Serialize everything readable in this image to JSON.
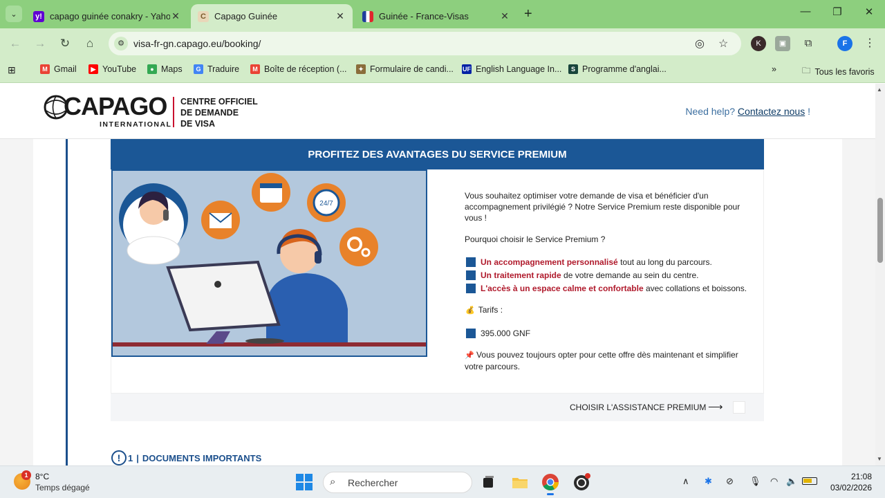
{
  "browser": {
    "tabs": [
      {
        "title": "capago guinée conakry - Yahoo",
        "favicon": "yahoo-icon",
        "active": false
      },
      {
        "title": "Capago Guinée",
        "favicon": "capago-icon",
        "active": true
      },
      {
        "title": "Guinée - France-Visas",
        "favicon": "france-flag-icon",
        "active": false
      }
    ],
    "close_glyph": "✕",
    "new_tab_glyph": "+",
    "url": "visa-fr-gn.capago.eu/booking/",
    "profile_letter": "F",
    "ext_letter": "K",
    "bookmarks": [
      {
        "label": "Gmail",
        "icon": "gmail-icon",
        "color": "#ea4335"
      },
      {
        "label": "YouTube",
        "icon": "youtube-icon",
        "color": "#ff0000"
      },
      {
        "label": "Maps",
        "icon": "maps-icon",
        "color": "#34a853"
      },
      {
        "label": "Traduire",
        "icon": "translate-icon",
        "color": "#4285f4"
      },
      {
        "label": "Boîte de réception (...",
        "icon": "gmail-icon",
        "color": "#ea4335"
      },
      {
        "label": "Formulaire de candi...",
        "icon": "emblem-icon",
        "color": "#8a6d3b"
      },
      {
        "label": "English Language In...",
        "icon": "uf-icon",
        "color": "#0021a5"
      },
      {
        "label": "Programme d'anglai...",
        "icon": "msu-icon",
        "color": "#18453b"
      }
    ],
    "all_bookmarks": "Tous les favoris"
  },
  "site": {
    "logo_main": "CAPAGO",
    "logo_sub": "INTERNATIONAL",
    "logo_lines": [
      "CENTRE OFFICIEL",
      "DE DEMANDE",
      "DE VISA"
    ],
    "help_text": "Need help?",
    "help_link": "Contactez nous",
    "help_suffix": "!"
  },
  "premium": {
    "banner": "PROFITEZ DES AVANTAGES DU SERVICE PREMIUM",
    "intro": "Vous souhaitez optimiser votre demande de visa et bénéficier d'un accompagnement privilégié ? Notre Service Premium reste disponible pour vous !",
    "why": "Pourquoi choisir le Service Premium ?",
    "benefits": [
      {
        "highlight": "Un accompagnement personnalisé",
        "rest": " tout au long du parcours."
      },
      {
        "highlight": "Un traitement rapide",
        "rest": " de votre demande au sein du centre."
      },
      {
        "highlight": "L'accès à un espace calme et confortable",
        "rest": " avec collations et boissons."
      }
    ],
    "tarifs_icon": "money-bag-icon",
    "tarifs_label": "Tarifs :",
    "price": "395.000 GNF",
    "note_icon": "pushpin-icon",
    "note": "Vous pouvez toujours opter pour cette offre dès maintenant et simplifier votre parcours.",
    "cta": "CHOISIR L'ASSISTANCE PREMIUM",
    "cta_arrow": "⟶"
  },
  "documents": {
    "number": "1",
    "separator": "|",
    "title": "DOCUMENTS IMPORTANTS"
  },
  "taskbar": {
    "weather_badge": "1",
    "temperature": "8°C",
    "weather_desc": "Temps dégagé",
    "search_placeholder": "Rechercher",
    "time": "21:08",
    "date": "03/02/2026"
  }
}
